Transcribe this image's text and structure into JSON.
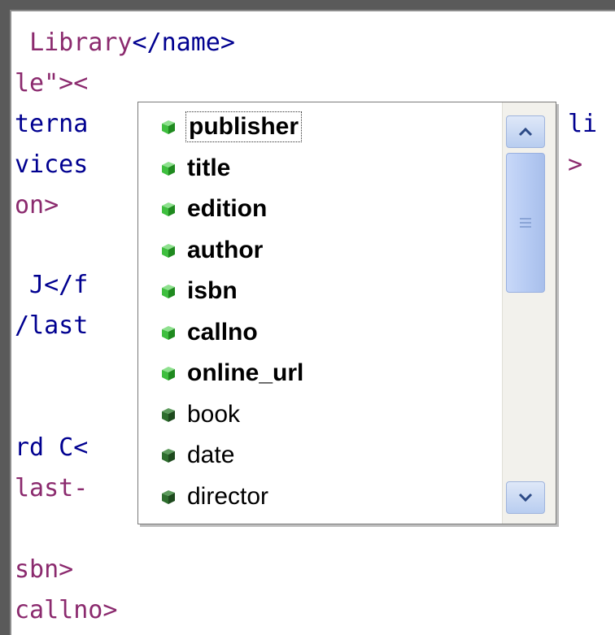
{
  "editor": {
    "lines": [
      {
        "plain": " ",
        "tag": "Library",
        "rest": "</name>"
      },
      {
        "plain": "le\"><",
        "tag": "",
        "rest": ""
      },
      {
        "plain": "terna",
        "tag": "",
        "rest": ""
      },
      {
        "plain": "vices",
        "tag": "",
        "rest": ""
      },
      {
        "plain": "on>",
        "tag": "",
        "rest": ""
      },
      {
        "plain": "",
        "tag": "",
        "rest": ""
      },
      {
        "plain": " J</f",
        "tag": "",
        "rest": ""
      },
      {
        "plain": "/last",
        "tag": "",
        "rest": ""
      },
      {
        "plain": "",
        "tag": "",
        "rest": ""
      },
      {
        "plain": "",
        "tag": "",
        "rest": ""
      },
      {
        "plain": "rd C<",
        "tag": "",
        "rest": ""
      },
      {
        "plain": "last-",
        "tag": "",
        "rest": ""
      },
      {
        "plain": "",
        "tag": "",
        "rest": ""
      },
      {
        "plain": "sbn>",
        "tag": "",
        "rest": ""
      },
      {
        "plain": "callno>",
        "tag": "",
        "rest": ""
      }
    ],
    "right_fragments": [
      "li",
      ">"
    ]
  },
  "autocomplete": {
    "items": [
      {
        "label": "publisher",
        "bold": true,
        "selected": true,
        "icon": "green-cube-icon"
      },
      {
        "label": "title",
        "bold": true,
        "selected": false,
        "icon": "green-cube-icon"
      },
      {
        "label": "edition",
        "bold": true,
        "selected": false,
        "icon": "green-cube-icon"
      },
      {
        "label": "author",
        "bold": true,
        "selected": false,
        "icon": "green-cube-icon"
      },
      {
        "label": "isbn",
        "bold": true,
        "selected": false,
        "icon": "green-cube-icon"
      },
      {
        "label": "callno",
        "bold": true,
        "selected": false,
        "icon": "green-cube-icon"
      },
      {
        "label": "online_url",
        "bold": true,
        "selected": false,
        "icon": "green-cube-icon"
      },
      {
        "label": "book",
        "bold": false,
        "selected": false,
        "icon": "dark-green-cube-icon"
      },
      {
        "label": "date",
        "bold": false,
        "selected": false,
        "icon": "dark-green-cube-icon"
      },
      {
        "label": "director",
        "bold": false,
        "selected": false,
        "icon": "dark-green-cube-icon"
      }
    ],
    "colors": {
      "bright_cube": "#3fbf3f",
      "dark_cube": "#2e6e2e"
    }
  }
}
